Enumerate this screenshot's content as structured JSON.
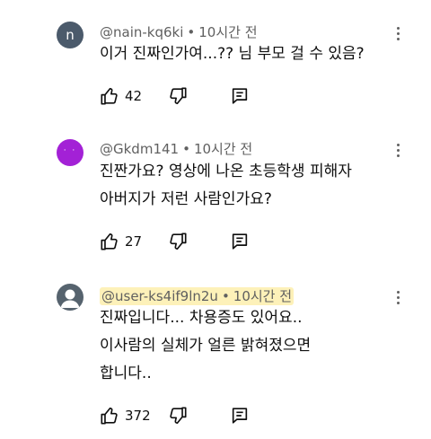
{
  "comments": [
    {
      "author": "@nain-kq6ki",
      "time": "10시간 전",
      "avatar_letter": "n",
      "avatar_color": "#4b5a6b",
      "text": "이거 진짜인가여...?? 님 부모 걸 수 있음?",
      "likes": "42"
    },
    {
      "author": "@Gkdm141",
      "time": "10시간 전",
      "avatar_color": "#a321d6",
      "text": "진짠가요? 영상에 나온 초등학생 피해자\n아버지가 저런 사람인가요?",
      "likes": "27"
    },
    {
      "author": "@user-ks4if9ln2u",
      "time": "10시간 전",
      "avatar_color": "#56636e",
      "highlight_color": "#fdf1b9",
      "text": "진짜입니다... 차용증도 있어요..\n이사람의 실체가 얼른 밝혀졌으면\n합니다..",
      "likes": "372"
    }
  ],
  "separator": "•",
  "icons": [
    "like-icon",
    "dislike-icon",
    "reply-icon",
    "more-vert-icon",
    "person-avatar-icon"
  ]
}
